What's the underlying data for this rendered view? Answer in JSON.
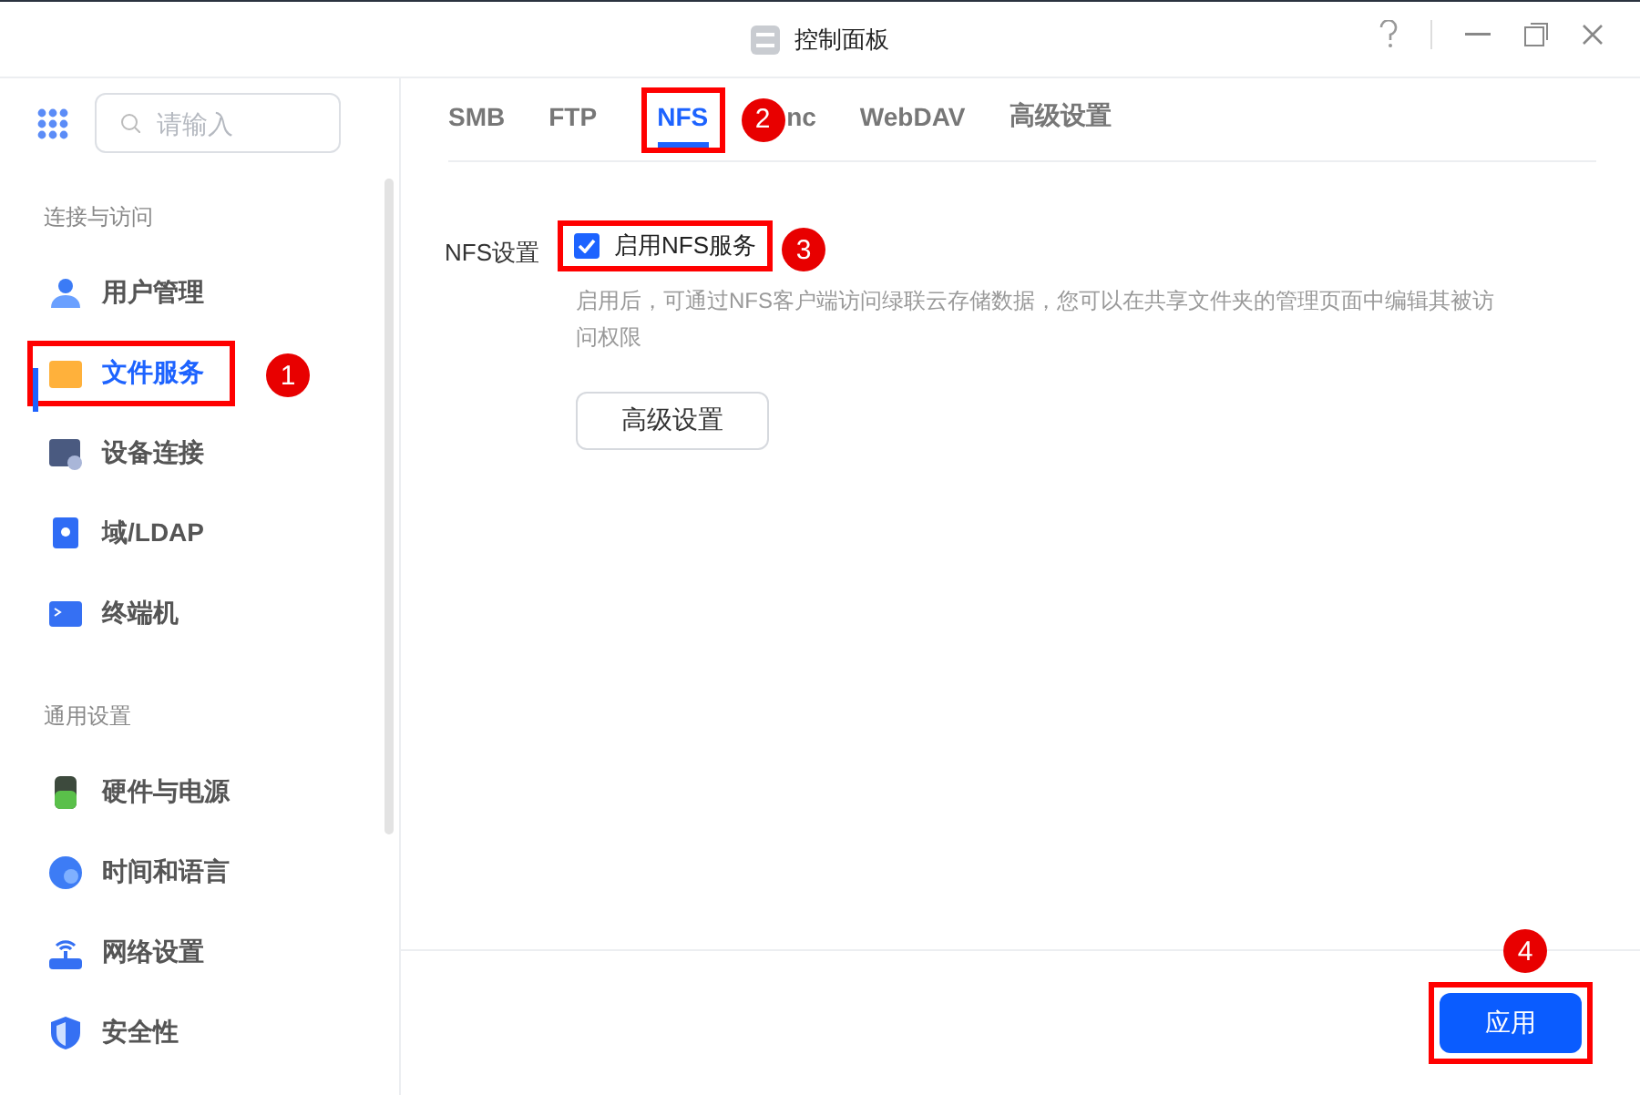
{
  "window": {
    "title": "控制面板"
  },
  "sidebar": {
    "search": {
      "placeholder": "请输入"
    },
    "groups": [
      {
        "label": "连接与访问",
        "items": [
          {
            "label": "用户管理",
            "selected": false
          },
          {
            "label": "文件服务",
            "selected": true,
            "callout": "1"
          },
          {
            "label": "设备连接",
            "selected": false
          },
          {
            "label": "域/LDAP",
            "selected": false
          },
          {
            "label": "终端机",
            "selected": false
          }
        ]
      },
      {
        "label": "通用设置",
        "items": [
          {
            "label": "硬件与电源",
            "selected": false
          },
          {
            "label": "时间和语言",
            "selected": false
          },
          {
            "label": "网络设置",
            "selected": false
          },
          {
            "label": "安全性",
            "selected": false
          }
        ]
      }
    ]
  },
  "tabs": [
    {
      "label": "SMB",
      "selected": false
    },
    {
      "label": "FTP",
      "selected": false
    },
    {
      "label": "NFS",
      "selected": true,
      "callout": "2"
    },
    {
      "label": "nc",
      "selected": false
    },
    {
      "label": "WebDAV",
      "selected": false
    },
    {
      "label": "高级设置",
      "selected": false
    }
  ],
  "setting": {
    "label": "NFS设置",
    "option": {
      "label": "启用NFS服务",
      "checked": true,
      "callout": "3"
    },
    "hint": "启用后，可通过NFS客户端访问绿联云存储数据，您可以在共享文件夹的管理页面中编辑其被访问权限",
    "button": "高级设置"
  },
  "footer": {
    "apply": {
      "label": "应用",
      "callout": "4"
    }
  }
}
